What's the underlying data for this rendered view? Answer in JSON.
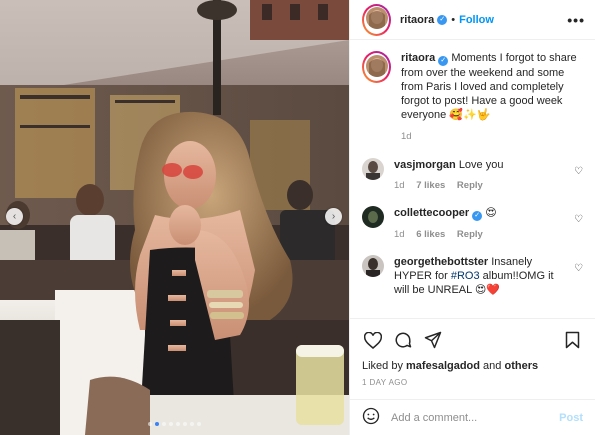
{
  "post": {
    "author": "ritaora",
    "follow_label": "Follow",
    "more_label": "•••"
  },
  "carousel": {
    "slide_count": 8,
    "active_index": 1,
    "prev_label": "‹",
    "next_label": "›"
  },
  "caption": {
    "username": "ritaora",
    "text": "Moments I forgot to share from over the weekend and some from Paris I loved and completely forgot to post! Have a good week everyone 🥰✨🤟",
    "time": "1d"
  },
  "comments": [
    {
      "username": "vasjmorgan",
      "verified": false,
      "text": "Love you",
      "time": "1d",
      "likes": "7 likes",
      "reply": "Reply"
    },
    {
      "username": "collettecooper",
      "verified": true,
      "text": "😍",
      "time": "1d",
      "likes": "6 likes",
      "reply": "Reply"
    },
    {
      "username": "georgethebottster",
      "verified": false,
      "text_pre": "Insanely HYPER for ",
      "hashtag": "#RO3",
      "text_post": " album!!OMG it will be UNREAL 😍❤️"
    }
  ],
  "likes": {
    "prefix": "Liked by ",
    "user": "mafesalgadod",
    "middle": " and ",
    "others": "others"
  },
  "timestamp": "1 DAY AGO",
  "add_comment": {
    "placeholder": "Add a comment...",
    "post_label": "Post"
  },
  "icons": {
    "like": "heart-icon",
    "comment": "comment-icon",
    "share": "share-icon",
    "save": "bookmark-icon",
    "emoji": "emoji-icon",
    "verified": "verified-badge-icon"
  },
  "colors": {
    "follow_blue": "#0095f6",
    "verified_blue": "#3897f0",
    "hashtag": "#00376b",
    "post_disabled": "#b2dffc",
    "muted": "#8e8e8e"
  }
}
